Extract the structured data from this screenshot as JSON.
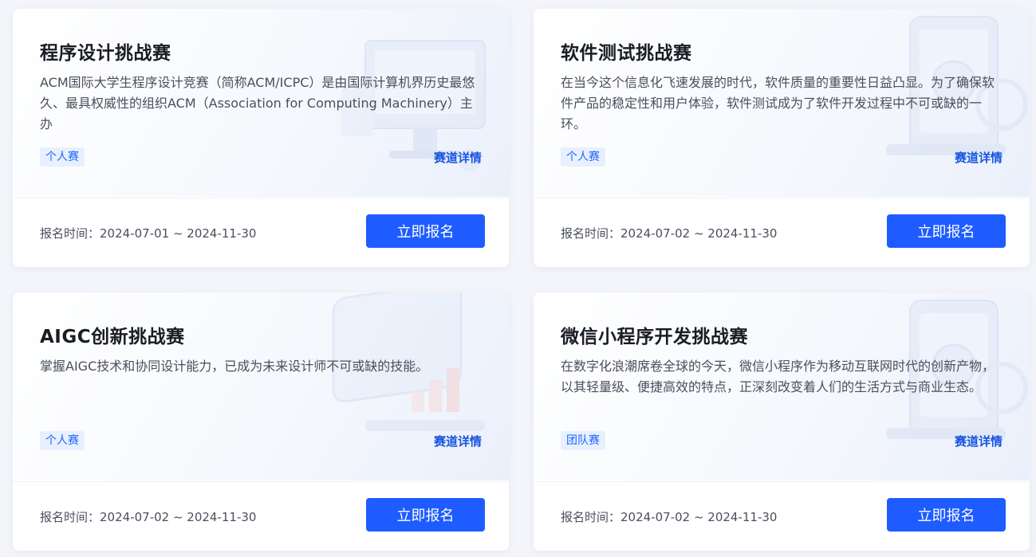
{
  "cards": [
    {
      "title": "程序设计挑战赛",
      "description": "ACM国际大学生程序设计竞赛（简称ACM/ICPC）是由国际计算机界历史最悠久、最具权威性的组织ACM（Association for Computing Machinery）主办",
      "tag": "个人赛",
      "detail_label": "赛道详情",
      "time_label": "报名时间：",
      "time_range": "2024-07-01 ~ 2024-11-30",
      "button_label": "立即报名",
      "decoration": "monitor-illustration"
    },
    {
      "title": "软件测试挑战赛",
      "description": "在当今这个信息化飞速发展的时代，软件质量的重要性日益凸显。为了确保软件产品的稳定性和用户体验，软件测试成为了软件开发过程中不可或缺的一环。",
      "tag": "个人赛",
      "detail_label": "赛道详情",
      "time_label": "报名时间：",
      "time_range": "2024-07-02 ~ 2024-11-30",
      "button_label": "立即报名",
      "decoration": "phone-illustration"
    },
    {
      "title": "AIGC创新挑战赛",
      "description": "掌握AIGC技术和协同设计能力，已成为未来设计师不可或缺的技能。",
      "tag": "个人赛",
      "detail_label": "赛道详情",
      "time_label": "报名时间：",
      "time_range": "2024-07-02 ~ 2024-11-30",
      "button_label": "立即报名",
      "decoration": "aigc-illustration"
    },
    {
      "title": "微信小程序开发挑战赛",
      "description": "在数字化浪潮席卷全球的今天，微信小程序作为移动互联网时代的创新产物，以其轻量级、便捷高效的特点，正深刻改变着人们的生活方式与商业生态。",
      "tag": "团队赛",
      "detail_label": "赛道详情",
      "time_label": "报名时间：",
      "time_range": "2024-07-02 ~ 2024-11-30",
      "button_label": "立即报名",
      "decoration": "phone-illustration"
    }
  ],
  "colors": {
    "primary": "#1e5cff",
    "link": "#1654e0",
    "tag_bg": "#e8f0ff",
    "title": "#1a1d24",
    "text": "#4a4f5c"
  }
}
